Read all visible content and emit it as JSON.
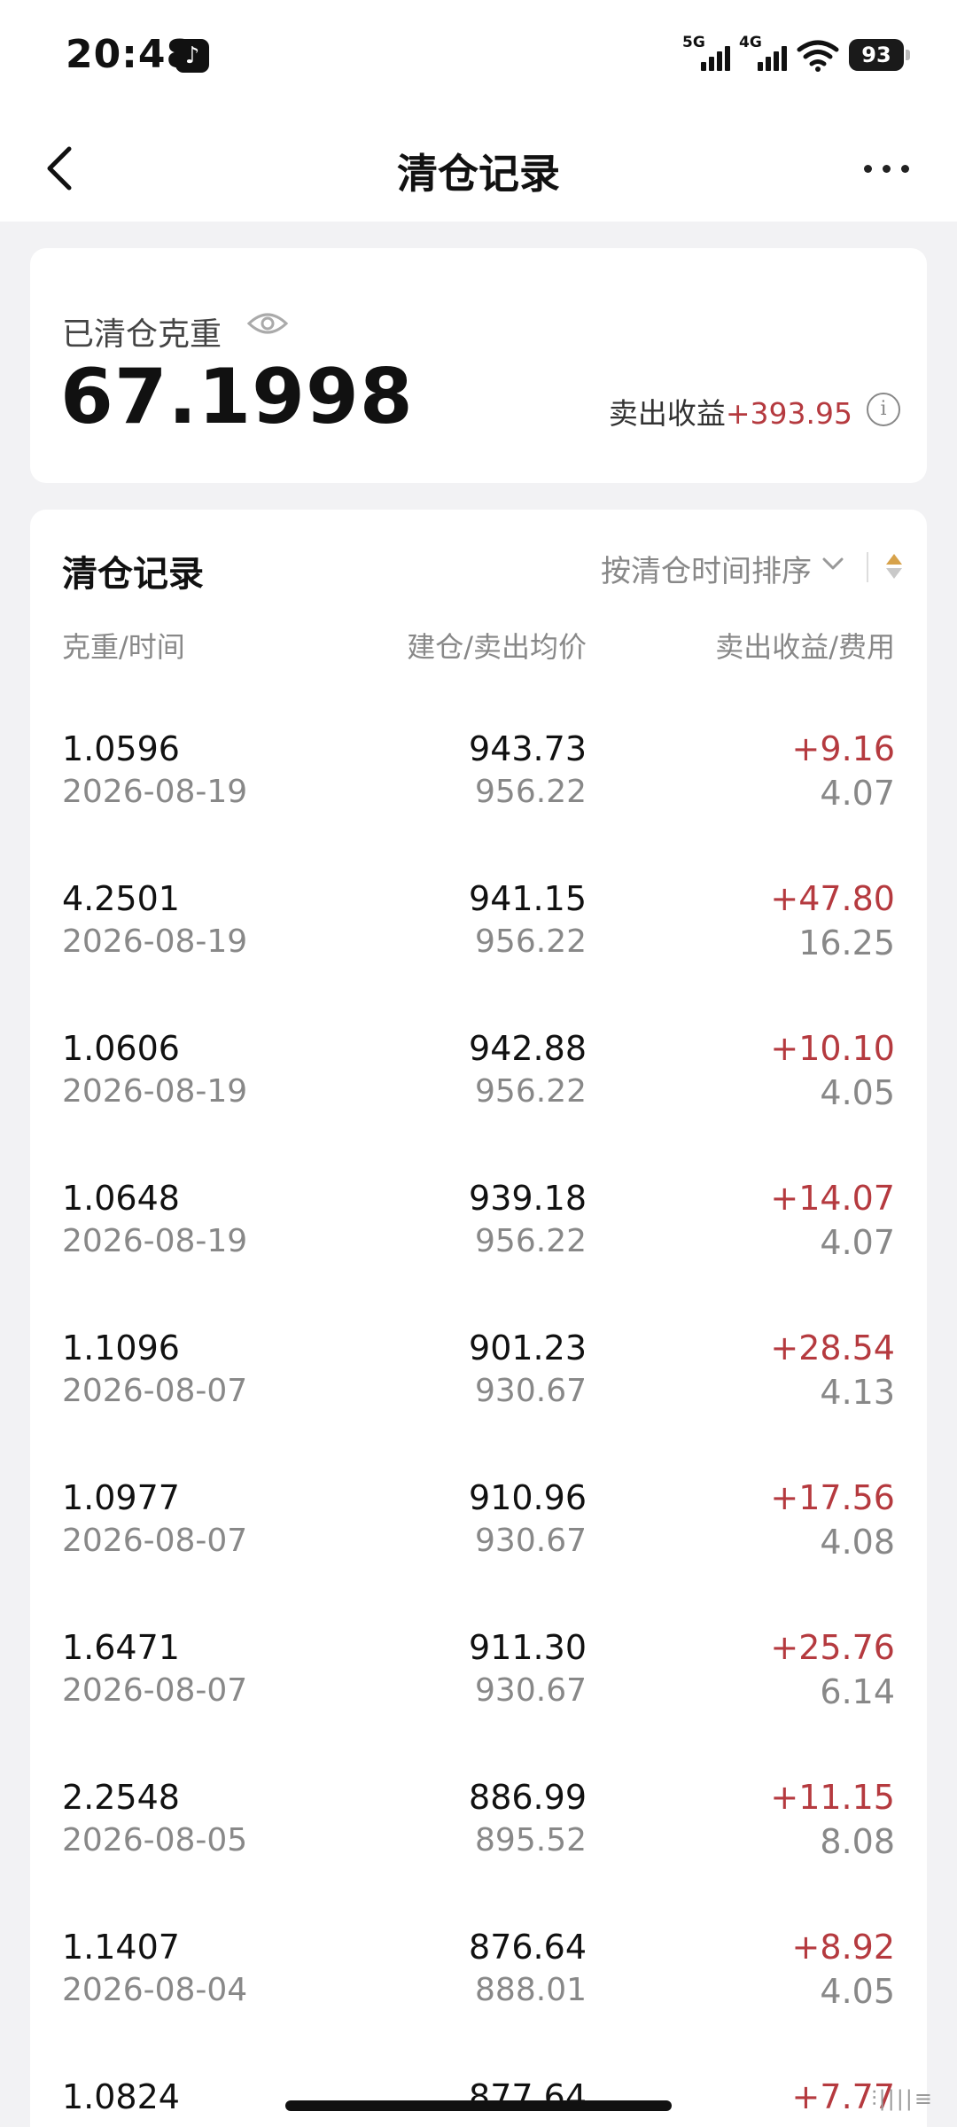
{
  "status_bar": {
    "time": "20:48",
    "app_icon": "tiktok-icon",
    "signal_1_label": "5G",
    "signal_2_label": "4G",
    "battery": "93"
  },
  "header": {
    "title": "清仓记录",
    "back_icon": "chevron-left-icon",
    "more_icon": "more-icon"
  },
  "summary": {
    "label": "已清仓克重",
    "weight": "67.1998",
    "profit_label": "卖出收益",
    "profit_value": "+393.95",
    "info_glyph": "i"
  },
  "records": {
    "title": "清仓记录",
    "sort_label": "按清仓时间排序",
    "columns": [
      "克重/时间",
      "建仓/卖出均价",
      "卖出收益/费用"
    ],
    "rows": [
      {
        "weight": "1.0596",
        "date": "2026-08-19",
        "buy": "943.73",
        "sell": "956.22",
        "gain": "+9.16",
        "fee": "4.07"
      },
      {
        "weight": "4.2501",
        "date": "2026-08-19",
        "buy": "941.15",
        "sell": "956.22",
        "gain": "+47.80",
        "fee": "16.25"
      },
      {
        "weight": "1.0606",
        "date": "2026-08-19",
        "buy": "942.88",
        "sell": "956.22",
        "gain": "+10.10",
        "fee": "4.05"
      },
      {
        "weight": "1.0648",
        "date": "2026-08-19",
        "buy": "939.18",
        "sell": "956.22",
        "gain": "+14.07",
        "fee": "4.07"
      },
      {
        "weight": "1.1096",
        "date": "2026-08-07",
        "buy": "901.23",
        "sell": "930.67",
        "gain": "+28.54",
        "fee": "4.13"
      },
      {
        "weight": "1.0977",
        "date": "2026-08-07",
        "buy": "910.96",
        "sell": "930.67",
        "gain": "+17.56",
        "fee": "4.08"
      },
      {
        "weight": "1.6471",
        "date": "2026-08-07",
        "buy": "911.30",
        "sell": "930.67",
        "gain": "+25.76",
        "fee": "6.14"
      },
      {
        "weight": "2.2548",
        "date": "2026-08-05",
        "buy": "886.99",
        "sell": "895.52",
        "gain": "+11.15",
        "fee": "8.08"
      },
      {
        "weight": "1.1407",
        "date": "2026-08-04",
        "buy": "876.64",
        "sell": "888.01",
        "gain": "+8.92",
        "fee": "4.05"
      },
      {
        "weight": "1.0824",
        "date": "",
        "buy": "877.64",
        "sell": "",
        "gain": "+7.77",
        "fee": ""
      }
    ]
  },
  "colors": {
    "profit_red": "#b53a3f",
    "secondary_gray": "#888888",
    "background": "#f2f2f4"
  }
}
